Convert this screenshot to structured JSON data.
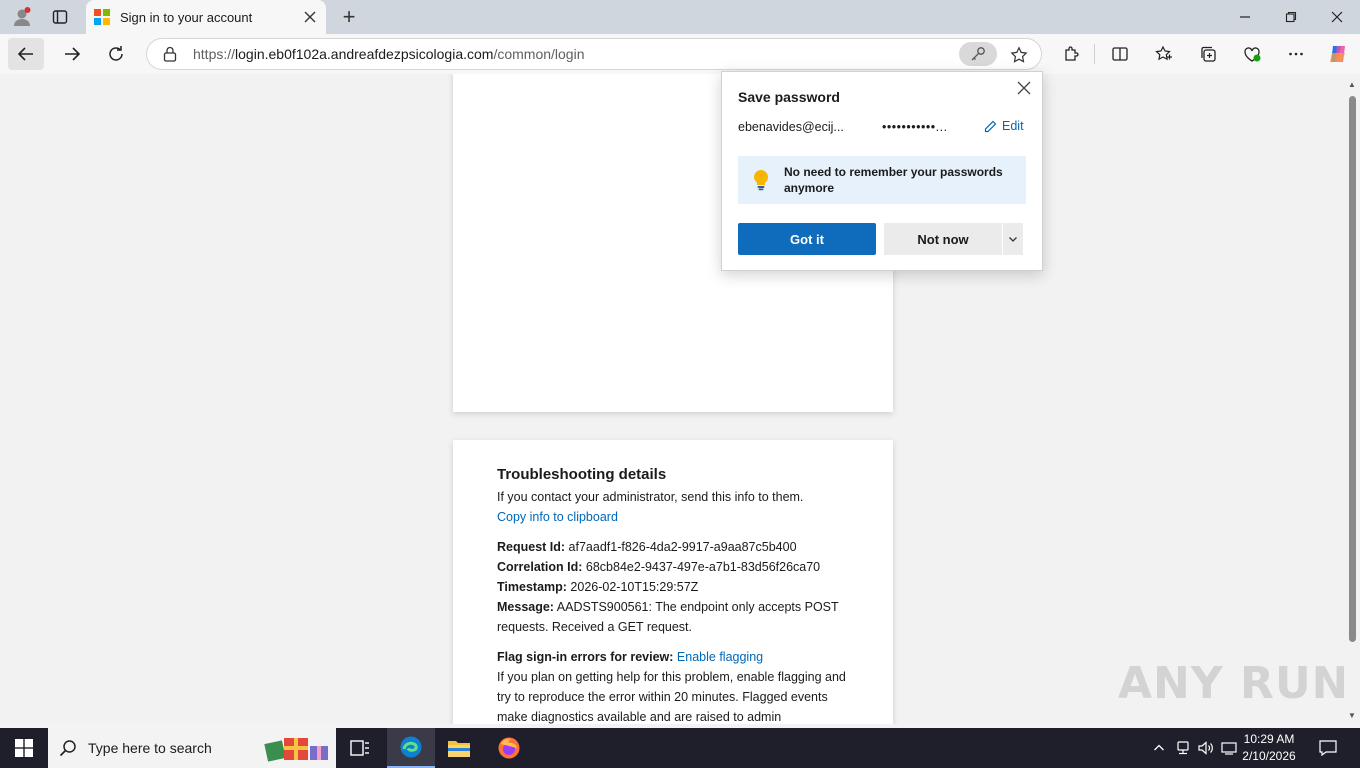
{
  "browser": {
    "tab_title": "Sign in to your account",
    "new_tab_label": "+",
    "url_prefix": "https://",
    "url_host": "login.eb0f102a.andreafdezpsicologia.com",
    "url_path": "/common/login"
  },
  "popup": {
    "title": "Save password",
    "username": "ebenavides@ecij...",
    "password_mask": "•••••••••••...",
    "edit_label": "Edit",
    "tip_text": "No need to remember your passwords anymore",
    "primary_button": "Got it",
    "secondary_button": "Not now"
  },
  "troubleshooting": {
    "heading": "Troubleshooting details",
    "intro": "If you contact your administrator, send this info to them.",
    "copy_link": "Copy info to clipboard",
    "request_id_label": "Request Id:",
    "request_id": "af7aadf1-f826-4da2-9917-a9aa87c5b400",
    "correlation_id_label": "Correlation Id:",
    "correlation_id": "68cb84e2-9437-497e-a7b1-83d56f26ca70",
    "timestamp_label": "Timestamp:",
    "timestamp": "2026-02-10T15:29:57Z",
    "message_label": "Message:",
    "message": "AADSTS900561: The endpoint only accepts POST requests. Received a GET request.",
    "flag_label": "Flag sign-in errors for review:",
    "flag_link": "Enable flagging",
    "flag_text": "If you plan on getting help for this problem, enable flagging and try to reproduce the error within 20 minutes. Flagged events make diagnostics available and are raised to admin"
  },
  "watermark": "ANY RUN",
  "taskbar": {
    "search_placeholder": "Type here to search",
    "time": "10:29 AM",
    "date": "2/10/2026"
  },
  "colors": {
    "accent": "#0f6cbd",
    "link": "#0067b8",
    "tip_bg": "#e6f1fb",
    "taskbar": "#1f1f2b"
  },
  "icons": [
    "profile-icon",
    "tab-actions-icon",
    "microsoft-logo-icon",
    "close-icon",
    "back-icon",
    "forward-icon",
    "refresh-icon",
    "lock-icon",
    "key-icon",
    "star-icon",
    "extensions-icon",
    "split-screen-icon",
    "favorites-icon",
    "collections-icon",
    "browser-essentials-icon",
    "more-icon",
    "copilot-icon",
    "lightbulb-icon",
    "pencil-icon",
    "chevron-down-icon",
    "windows-start-icon",
    "search-icon",
    "task-view-icon",
    "edge-icon",
    "file-explorer-icon",
    "firefox-icon"
  ]
}
